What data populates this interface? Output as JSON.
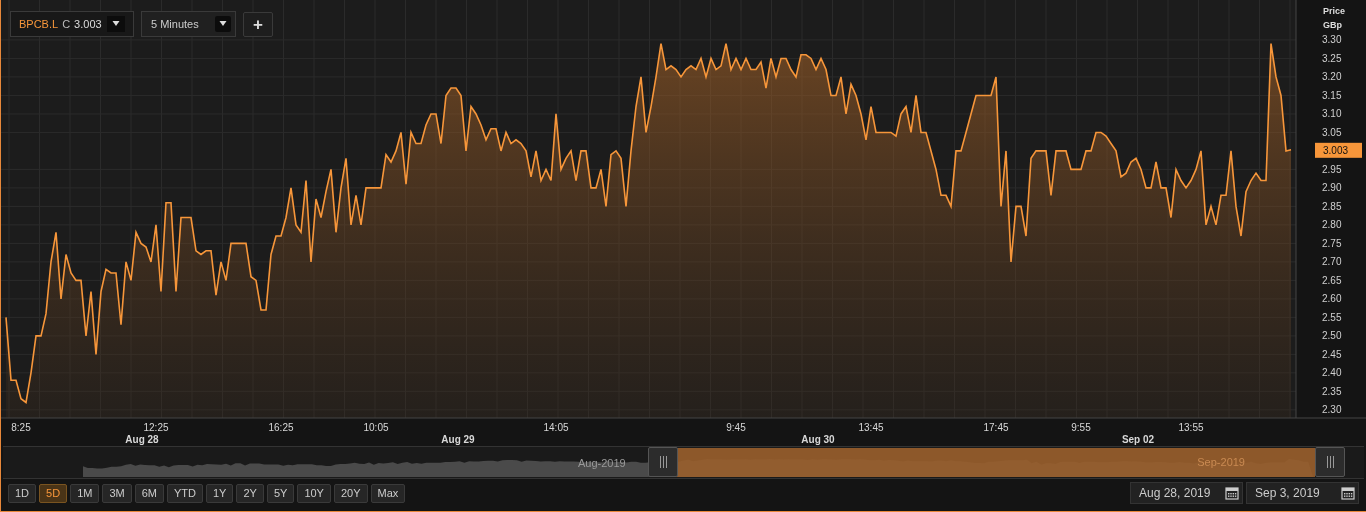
{
  "toolbar": {
    "symbol": "BPCB.L",
    "close_label": "C",
    "close_value": "3.003",
    "interval": "5 Minutes",
    "add_button": "+"
  },
  "chart": {
    "unit": "GBp",
    "last_price_tag": "3.003",
    "chart_data": {
      "type": "area",
      "ylabel": "Price",
      "values": [
        2.55,
        2.38,
        2.38,
        2.33,
        2.32,
        2.4,
        2.5,
        2.5,
        2.56,
        2.7,
        2.78,
        2.6,
        2.72,
        2.67,
        2.65,
        2.65,
        2.5,
        2.62,
        2.45,
        2.62,
        2.68,
        2.67,
        2.67,
        2.53,
        2.7,
        2.65,
        2.78,
        2.75,
        2.74,
        2.7,
        2.8,
        2.62,
        2.86,
        2.86,
        2.62,
        2.82,
        2.82,
        2.82,
        2.73,
        2.72,
        2.73,
        2.73,
        2.61,
        2.7,
        2.65,
        2.75,
        2.75,
        2.75,
        2.75,
        2.66,
        2.65,
        2.57,
        2.57,
        2.72,
        2.77,
        2.77,
        2.82,
        2.9,
        2.8,
        2.78,
        2.92,
        2.7,
        2.87,
        2.82,
        2.89,
        2.95,
        2.78,
        2.9,
        2.98,
        2.8,
        2.88,
        2.8,
        2.9,
        2.9,
        2.9,
        2.9,
        2.99,
        2.97,
        3.0,
        3.05,
        2.91,
        3.05,
        3.02,
        3.02,
        3.07,
        3.1,
        3.1,
        3.02,
        3.15,
        3.17,
        3.17,
        3.15,
        3.0,
        3.12,
        3.1,
        3.07,
        3.03,
        3.06,
        3.06,
        3.0,
        3.05,
        3.02,
        3.03,
        3.02,
        3.0,
        2.93,
        3.0,
        2.92,
        2.95,
        2.92,
        3.1,
        2.95,
        2.98,
        3.0,
        2.92,
        3.0,
        3.0,
        2.9,
        2.9,
        2.95,
        2.85,
        2.99,
        3.0,
        2.98,
        2.85,
        3.0,
        3.12,
        3.2,
        3.05,
        3.12,
        3.2,
        3.29,
        3.22,
        3.23,
        3.22,
        3.2,
        3.22,
        3.23,
        3.22,
        3.25,
        3.2,
        3.25,
        3.22,
        3.23,
        3.29,
        3.22,
        3.25,
        3.22,
        3.25,
        3.22,
        3.22,
        3.24,
        3.17,
        3.25,
        3.2,
        3.25,
        3.25,
        3.22,
        3.2,
        3.26,
        3.26,
        3.25,
        3.22,
        3.25,
        3.22,
        3.15,
        3.15,
        3.2,
        3.1,
        3.18,
        3.15,
        3.1,
        3.03,
        3.12,
        3.05,
        3.05,
        3.05,
        3.05,
        3.04,
        3.1,
        3.12,
        3.05,
        3.15,
        3.05,
        3.05,
        3.0,
        2.95,
        2.88,
        2.88,
        2.85,
        3.0,
        3.0,
        3.05,
        3.1,
        3.15,
        3.15,
        3.15,
        3.15,
        3.2,
        2.85,
        3.0,
        2.7,
        2.85,
        2.85,
        2.77,
        2.98,
        3.0,
        3.0,
        3.0,
        2.88,
        3.0,
        3.0,
        3.0,
        2.95,
        2.95,
        2.95,
        3.0,
        3.0,
        3.05,
        3.05,
        3.04,
        3.02,
        3.0,
        2.93,
        2.94,
        2.97,
        2.98,
        2.95,
        2.9,
        2.9,
        2.97,
        2.9,
        2.9,
        2.82,
        2.95,
        2.92,
        2.9,
        2.92,
        2.95,
        3.0,
        2.8,
        2.85,
        2.8,
        2.88,
        2.88,
        3.0,
        2.85,
        2.77,
        2.89,
        2.92,
        2.94,
        2.92,
        2.92,
        3.29,
        3.2,
        3.15,
        3.0,
        3.003
      ],
      "categories": [
        null,
        null,
        null,
        "8:25",
        null,
        null,
        null,
        null,
        null,
        null,
        null,
        null,
        null,
        null,
        null,
        null,
        null,
        null,
        null,
        null,
        null,
        null,
        null,
        null,
        null,
        null,
        null,
        null,
        null,
        null,
        "12:25",
        null,
        null,
        null,
        null,
        null,
        null,
        null,
        null,
        null,
        null,
        null,
        null,
        null,
        null,
        null,
        null,
        null,
        null,
        null,
        null,
        null,
        null,
        null,
        null,
        "16:25",
        null,
        null,
        null,
        null,
        null,
        null,
        null,
        null,
        null,
        null,
        null,
        null,
        null,
        null,
        null,
        null,
        null,
        null,
        "10:05",
        null,
        null,
        null,
        null,
        null,
        null,
        null,
        null,
        null,
        null,
        null,
        null,
        null,
        null,
        null,
        null,
        null,
        null,
        null,
        null,
        null,
        null,
        null,
        null,
        null,
        null,
        null,
        null,
        null,
        null,
        null,
        null,
        null,
        null,
        null,
        "14:05",
        null,
        null,
        null,
        null,
        null,
        null,
        null,
        null,
        null,
        null,
        null,
        null,
        null,
        null,
        null,
        null,
        null,
        null,
        null,
        null,
        null,
        null,
        null,
        null,
        null,
        null,
        null,
        null,
        null,
        null,
        null,
        null,
        null,
        null,
        null,
        "9:45",
        null,
        null,
        null,
        null,
        null,
        null,
        null,
        null,
        null,
        null,
        null,
        null,
        null,
        null,
        null,
        null,
        null,
        null,
        null,
        null,
        null,
        null,
        null,
        null,
        null,
        null,
        "13:45",
        null,
        null,
        null,
        null,
        null,
        null,
        null,
        null,
        null,
        null,
        null,
        null,
        null,
        null,
        null,
        null,
        null,
        null,
        null,
        null,
        null,
        null,
        null,
        null,
        "17:45",
        null,
        null,
        null,
        null,
        null,
        null,
        null,
        null,
        null,
        null,
        null,
        null,
        null,
        null,
        null,
        null,
        "9:55",
        null,
        null,
        null,
        null,
        null,
        null,
        null,
        null,
        null,
        null,
        null,
        null,
        null,
        null,
        null,
        null,
        null,
        null,
        null,
        null,
        null,
        "13:55",
        null,
        null,
        null,
        null,
        null,
        null,
        null,
        null,
        null,
        null,
        null,
        null,
        null,
        null,
        null,
        null,
        null,
        null,
        null,
        null
      ],
      "ylim": [
        2.278,
        3.408
      ],
      "grid": true,
      "yticks": [
        {
          "value": 2.3,
          "label": "2.30"
        },
        {
          "value": 2.35,
          "label": "2.35"
        },
        {
          "value": 2.4,
          "label": "2.40"
        },
        {
          "value": 2.45,
          "label": "2.45"
        },
        {
          "value": 2.5,
          "label": "2.50"
        },
        {
          "value": 2.55,
          "label": "2.55"
        },
        {
          "value": 2.6,
          "label": "2.60"
        },
        {
          "value": 2.65,
          "label": "2.65"
        },
        {
          "value": 2.7,
          "label": "2.70"
        },
        {
          "value": 2.75,
          "label": "2.75"
        },
        {
          "value": 2.8,
          "label": "2.80"
        },
        {
          "value": 2.85,
          "label": "2.85"
        },
        {
          "value": 2.9,
          "label": "2.90"
        },
        {
          "value": 2.95,
          "label": "2.95"
        },
        {
          "value": 3.05,
          "label": "3.05"
        },
        {
          "value": 3.1,
          "label": "3.10"
        },
        {
          "value": 3.15,
          "label": "3.15"
        },
        {
          "value": 3.2,
          "label": "3.20"
        },
        {
          "value": 3.25,
          "label": "3.25"
        },
        {
          "value": 3.3,
          "label": "3.30"
        }
      ]
    },
    "date_labels": [
      "Aug 28",
      "Aug 29",
      "Aug 30",
      "Sep 02"
    ]
  },
  "navigator": {
    "left_label": "Aug-2019",
    "right_label": "Sep-2019"
  },
  "ranges": [
    {
      "label": "1D",
      "selected": false
    },
    {
      "label": "5D",
      "selected": true
    },
    {
      "label": "1M",
      "selected": false
    },
    {
      "label": "3M",
      "selected": false
    },
    {
      "label": "6M",
      "selected": false
    },
    {
      "label": "YTD",
      "selected": false
    },
    {
      "label": "1Y",
      "selected": false
    },
    {
      "label": "2Y",
      "selected": false
    },
    {
      "label": "5Y",
      "selected": false
    },
    {
      "label": "10Y",
      "selected": false
    },
    {
      "label": "20Y",
      "selected": false
    },
    {
      "label": "Max",
      "selected": false
    }
  ],
  "date_from": "Aug 28, 2019",
  "date_to": "Sep 3, 2019"
}
